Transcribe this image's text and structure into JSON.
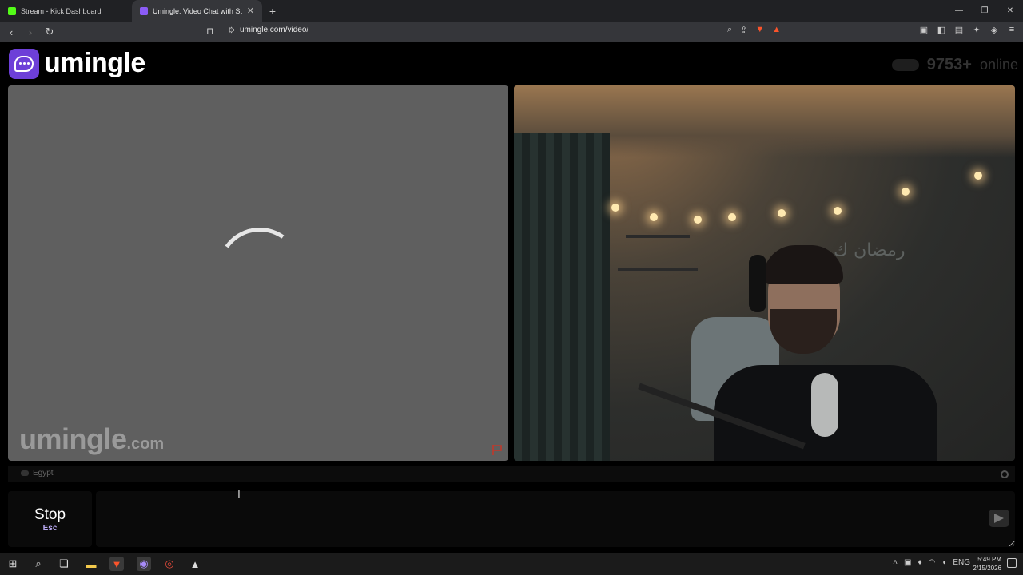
{
  "browser": {
    "tabs": [
      {
        "title": "Stream - Kick Dashboard",
        "active": false,
        "favicon_color": "#53fc18"
      },
      {
        "title": "Umingle: Video Chat with Str",
        "active": true,
        "favicon_color": "#8b5cf6"
      }
    ],
    "url": "umingle.com/video/"
  },
  "site": {
    "logo_text": "umingle",
    "online_count": "9753+",
    "online_label": "online",
    "accent_color": "#6d3fd8"
  },
  "remote_video": {
    "watermark_main": "umingle",
    "watermark_tld": ".com",
    "status": "loading"
  },
  "local_video": {
    "wall_text": "رمضان ك"
  },
  "country_bar": {
    "country": "Egypt"
  },
  "controls": {
    "stop_label": "Stop",
    "stop_shortcut": "Esc",
    "message_value": ""
  },
  "taskbar": {
    "language": "ENG",
    "time": "5:49 PM",
    "date": "2/15/2026"
  }
}
